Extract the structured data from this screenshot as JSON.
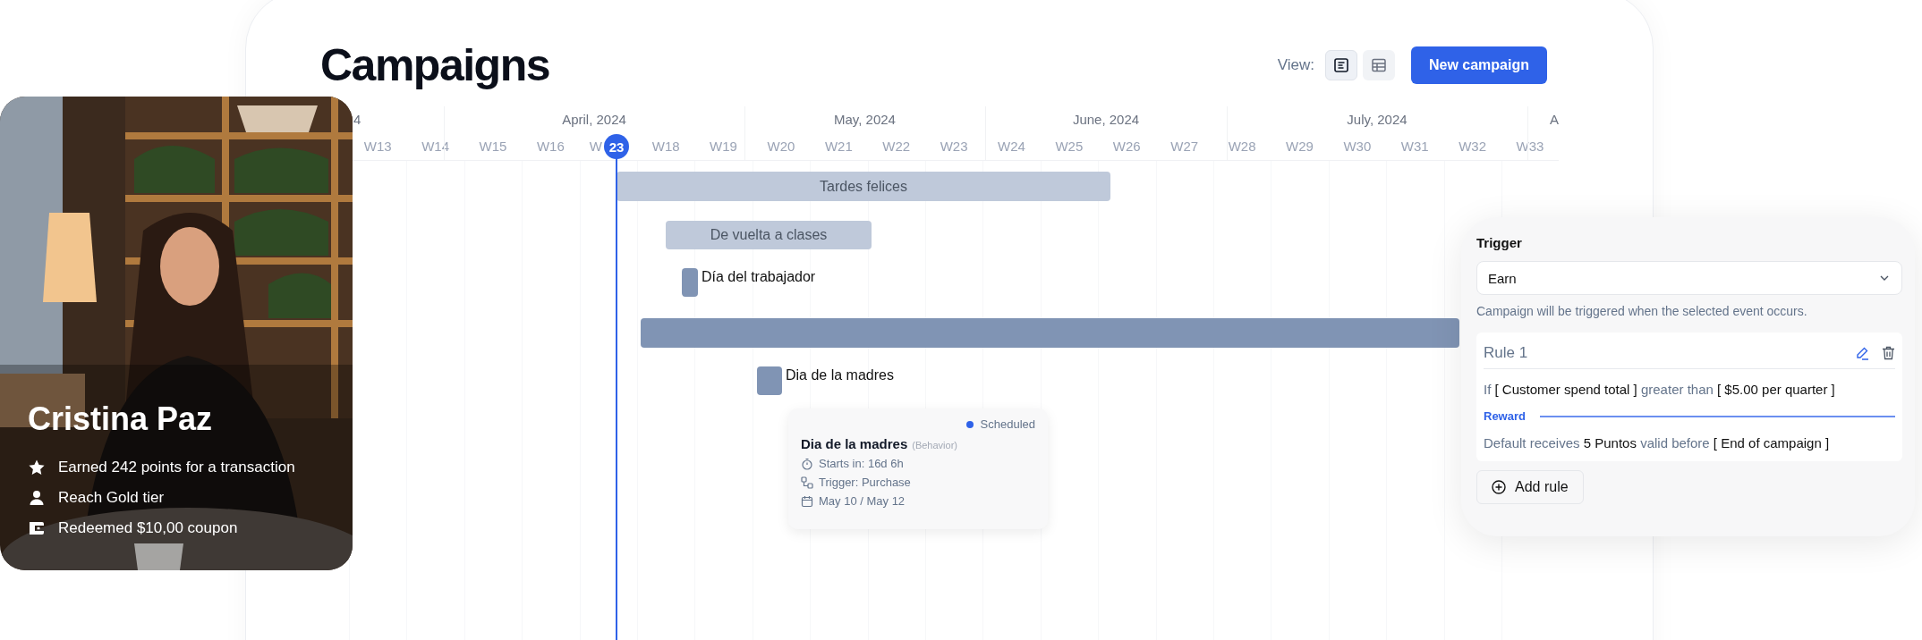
{
  "header": {
    "title": "Campaigns",
    "view_label": "View:",
    "view_options": [
      {
        "kind": "list",
        "selected": true
      },
      {
        "kind": "table",
        "selected": false
      }
    ],
    "new_button": "New campaign"
  },
  "timeline": {
    "months": [
      "4",
      "April, 2024",
      "May, 2024",
      "June, 2024",
      "July, 2024",
      "A"
    ],
    "weeks": [
      "W13",
      "W14",
      "W15",
      "W16",
      "W",
      "W18",
      "W19",
      "W20",
      "W21",
      "W22",
      "W23",
      "W24",
      "W25",
      "W26",
      "W27",
      "W28",
      "W29",
      "W30",
      "W31",
      "W32",
      "W33"
    ],
    "today": "23",
    "campaigns": [
      {
        "kind": "bar",
        "label": "Tardes felices"
      },
      {
        "kind": "bar",
        "label": "De vuelta a clases"
      },
      {
        "kind": "milestone",
        "label": "Día del trabajador"
      },
      {
        "kind": "bar"
      },
      {
        "kind": "milestone",
        "label": "Dia de la madres"
      }
    ],
    "tooltip": {
      "status": "Scheduled",
      "title": "Dia de la madres",
      "type": "(Behavior)",
      "details": [
        {
          "kind": "timer",
          "text": "Starts in: 16d 6h"
        },
        {
          "kind": "trigger",
          "text": "Trigger: Purchase"
        },
        {
          "kind": "date",
          "text": "May 10 / May 12"
        }
      ]
    }
  },
  "profile": {
    "kind": "picture",
    "name": "Cristina Paz",
    "activities": [
      {
        "kind": "star",
        "text": "Earned 242 points for a transaction"
      },
      {
        "kind": "person",
        "text": "Reach Gold tier"
      },
      {
        "kind": "wallet",
        "text": "Redeemed $10,00 coupon"
      }
    ]
  },
  "trigger_panel": {
    "label": "Trigger",
    "select": {
      "value": "Earn"
    },
    "hint": "Campaign will be triggered when the selected event occurs.",
    "rules": [
      {
        "title": "Rule 1",
        "condition": [
          {
            "kind": "keyword",
            "text": "If"
          },
          {
            "kind": "value",
            "text": "[ Customer spend total ]"
          },
          {
            "kind": "keyword",
            "text": "greater than"
          },
          {
            "kind": "value",
            "text": "[ $5.00 per quarter ]"
          }
        ],
        "reward_label": "Reward",
        "reward": [
          {
            "kind": "keyword",
            "text": "Default receives"
          },
          {
            "kind": "value",
            "text": "5 Puntos"
          },
          {
            "kind": "keyword",
            "text": "valid before"
          },
          {
            "kind": "value",
            "text": "[ End of campaign ]"
          }
        ]
      }
    ],
    "add_button": "Add rule"
  }
}
